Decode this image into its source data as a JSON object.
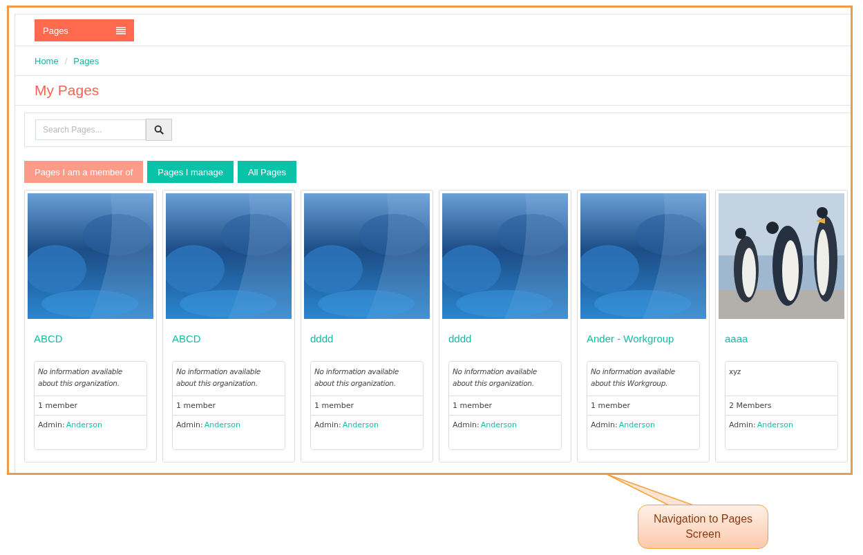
{
  "top_menu": {
    "label": "Pages"
  },
  "breadcrumb": [
    {
      "label": "Home"
    },
    {
      "label": "Pages"
    }
  ],
  "breadcrumb_separator": "/",
  "heading": "My Pages",
  "search": {
    "placeholder": "Search Pages..."
  },
  "tabs": [
    {
      "label": "Pages I am a member of",
      "selected": true
    },
    {
      "label": "Pages I manage",
      "selected": false
    },
    {
      "label": "All Pages",
      "selected": false
    }
  ],
  "cards": [
    {
      "title": "ABCD",
      "description": "No information available about this organization.",
      "description_italic": true,
      "members": "1 member",
      "admin_label": "Admin:",
      "admin_name": "Anderson"
    },
    {
      "title": "ABCD",
      "description": "No information available about this organization.",
      "description_italic": true,
      "members": "1 member",
      "admin_label": "Admin:",
      "admin_name": "Anderson"
    },
    {
      "title": "dddd",
      "description": "No information available about this organization.",
      "description_italic": true,
      "members": "1 member",
      "admin_label": "Admin:",
      "admin_name": "Anderson"
    },
    {
      "title": "dddd",
      "description": "No information available about this organization.",
      "description_italic": true,
      "members": "1 member",
      "admin_label": "Admin:",
      "admin_name": "Anderson"
    },
    {
      "title": "Ander - Workgroup",
      "description": "No information available about this Workgroup.",
      "description_italic": true,
      "members": "1 member",
      "admin_label": "Admin:",
      "admin_name": "Anderson"
    },
    {
      "title": "aaaa",
      "description": "xyz",
      "description_italic": false,
      "members": "2 Members",
      "admin_label": "Admin:",
      "admin_name": "Anderson"
    }
  ],
  "callout": {
    "text": "Navigation to Pages Screen"
  }
}
